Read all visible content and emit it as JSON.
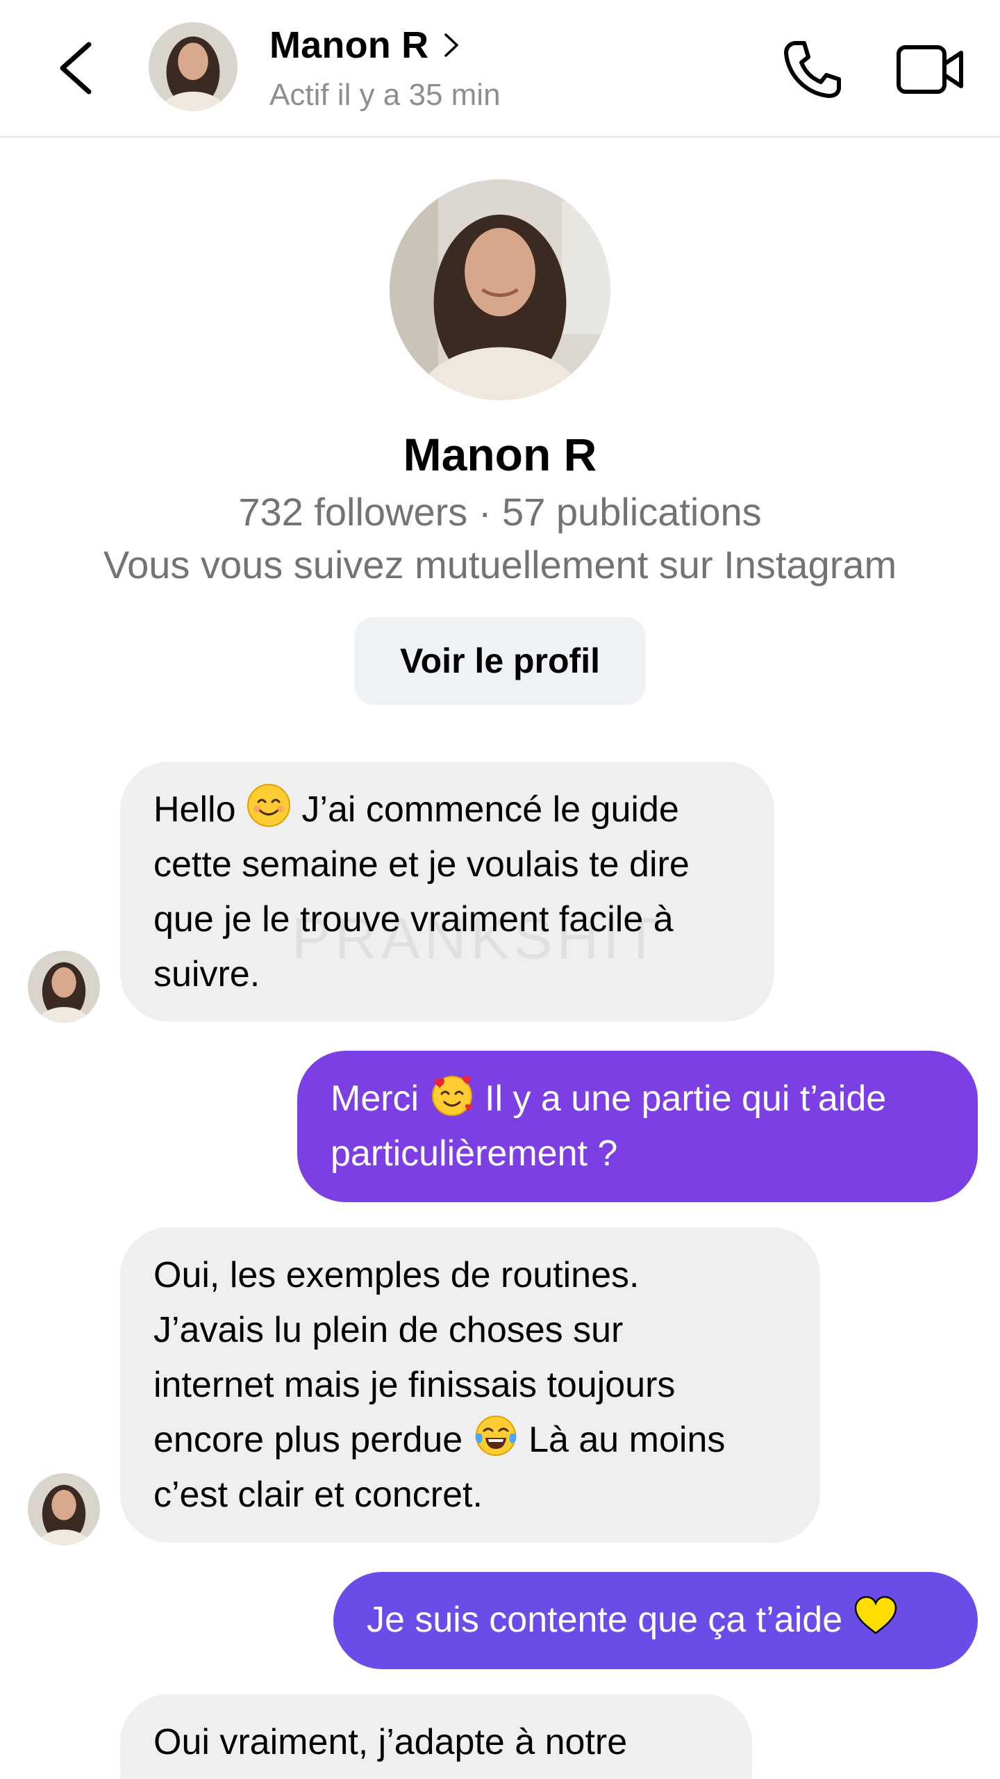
{
  "header": {
    "name": "Manon R",
    "status": "Actif il y a 35 min",
    "back_icon": "chevron-left-icon",
    "call_icon": "phone-icon",
    "video_icon": "video-camera-icon"
  },
  "profile": {
    "name": "Manon R",
    "stats": "732 followers · 57 publications",
    "mutual": "Vous vous suivez mutuellement sur Instagram",
    "button_label": "Voir le profil"
  },
  "watermark": "PRANKSHIT",
  "colors": {
    "incoming_bubble": "#efefef",
    "outgoing_purple_1": "#7b3fe4",
    "outgoing_purple_2": "#6a4de8",
    "secondary_text": "#737373"
  },
  "messages": [
    {
      "direction": "incoming",
      "lines": [
        [
          "Hello ",
          "😊",
          " J’ai commencé le guide"
        ],
        [
          "cette semaine et je voulais te dire"
        ],
        [
          "que je le trouve vraiment facile à"
        ],
        [
          "suivre."
        ]
      ]
    },
    {
      "direction": "outgoing",
      "lines": [
        [
          "Merci ",
          "🥰",
          " Il y a une partie qui t’aide"
        ],
        [
          "particulièrement ?"
        ]
      ]
    },
    {
      "direction": "incoming",
      "lines": [
        [
          "Oui, les exemples de routines."
        ],
        [
          "J’avais lu plein de choses sur"
        ],
        [
          "internet mais je finissais toujours"
        ],
        [
          "encore plus perdue ",
          "😂",
          " Là au moins"
        ],
        [
          "c’est clair et concret."
        ]
      ]
    },
    {
      "direction": "outgoing",
      "lines": [
        [
          "Je suis contente que ça t’aide ",
          "💛"
        ]
      ]
    },
    {
      "direction": "incoming",
      "lines": [
        [
          "Oui vraiment, j’adapte à notre"
        ]
      ]
    }
  ]
}
